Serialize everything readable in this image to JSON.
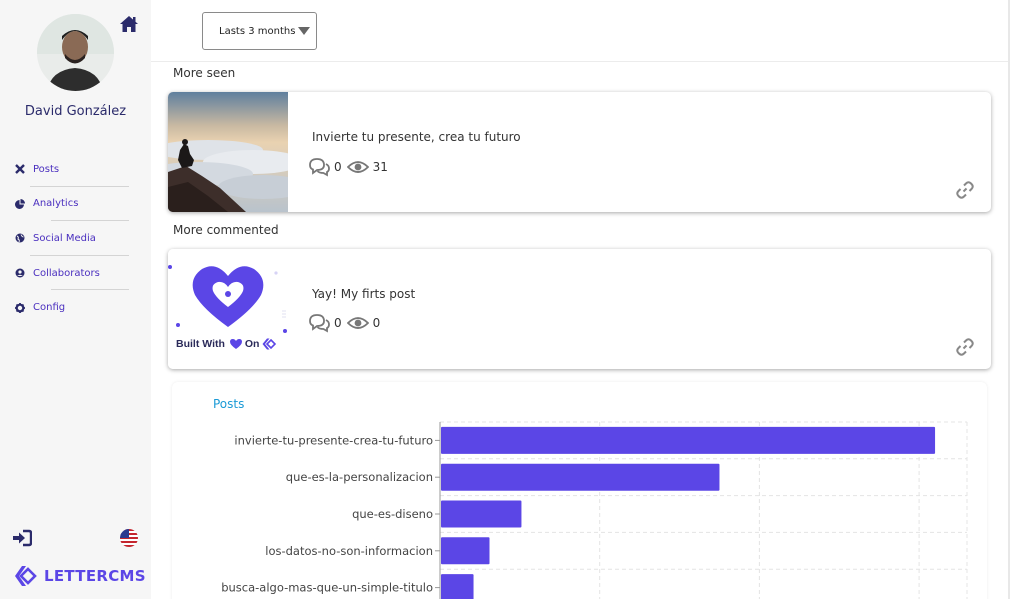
{
  "user": {
    "name": "David González"
  },
  "nav": [
    {
      "label": "Posts",
      "icon": "close-x-icon"
    },
    {
      "label": "Analytics",
      "icon": "pie-chart-icon"
    },
    {
      "label": "Social Media",
      "icon": "globe-icon"
    },
    {
      "label": "Collaborators",
      "icon": "user-circle-icon"
    },
    {
      "label": "Config",
      "icon": "gear-icon"
    }
  ],
  "brand": {
    "name": "LETTERCMS"
  },
  "filter": {
    "selected": "Lasts 3 months"
  },
  "sections": {
    "more_seen": {
      "title": "More seen",
      "post": {
        "title": "Invierte tu presente, crea tu futuro",
        "comments": "0",
        "views": "31"
      }
    },
    "more_commented": {
      "title": "More commented",
      "post": {
        "title": "Yay! My firts post",
        "comments": "0",
        "views": "0",
        "image_text": "Built With"
      }
    }
  },
  "colors": {
    "accent": "#5b46e6",
    "chart_title": "#1a9ad6",
    "nav_text": "#4a2fbf"
  },
  "chart_data": {
    "type": "bar",
    "orientation": "horizontal",
    "title": "Posts",
    "categories": [
      "invierte-tu-presente-crea-tu-futuro",
      "que-es-la-personalizacion",
      "que-es-diseno",
      "los-datos-no-son-informacion",
      "busca-algo-mas-que-un-simple-titulo"
    ],
    "values": [
      31,
      17.5,
      5.1,
      3.1,
      2.1
    ],
    "xlim": [
      0,
      33
    ],
    "grid": true,
    "bar_color": "#5b46e6"
  }
}
